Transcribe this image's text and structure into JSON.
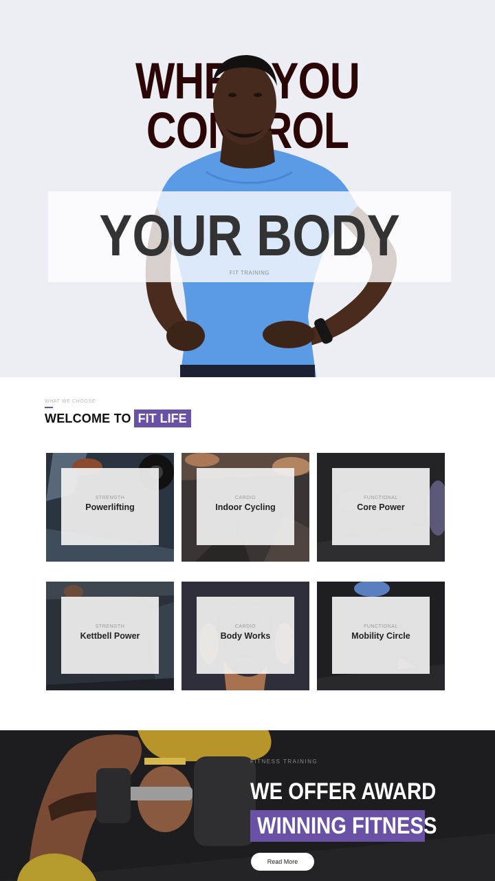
{
  "hero": {
    "headline_line1": "WHEN YOU",
    "headline_line2": "CONTROL",
    "box_title": "YOUR BODY",
    "box_subtitle": "FIT TRAINING"
  },
  "welcome": {
    "eyebrow": "WHAT WE CHOOSE",
    "title_plain": "WELCOME TO",
    "title_highlight": "FIT LIFE"
  },
  "cards": [
    {
      "category": "STRENGTH",
      "title": "Powerlifting"
    },
    {
      "category": "CARDIO",
      "title": "Indoor Cycling"
    },
    {
      "category": "FUNCTIONAL",
      "title": "Core Power"
    },
    {
      "category": "STRENGTH",
      "title": "Kettbell Power"
    },
    {
      "category": "CARDIO",
      "title": "Body Works"
    },
    {
      "category": "FUNCTIONAL",
      "title": "Mobility Circle"
    }
  ],
  "promo": {
    "eyebrow": "FITNESS TRAINING",
    "line1": "WE OFFER AWARD",
    "line2": "WINNING FITNESS",
    "button_label": "Read More"
  },
  "colors": {
    "accent": "#6951a6",
    "hero_bg": "#eceef3",
    "headline": "#2b0606",
    "dark_bg": "#1d1d1f"
  }
}
